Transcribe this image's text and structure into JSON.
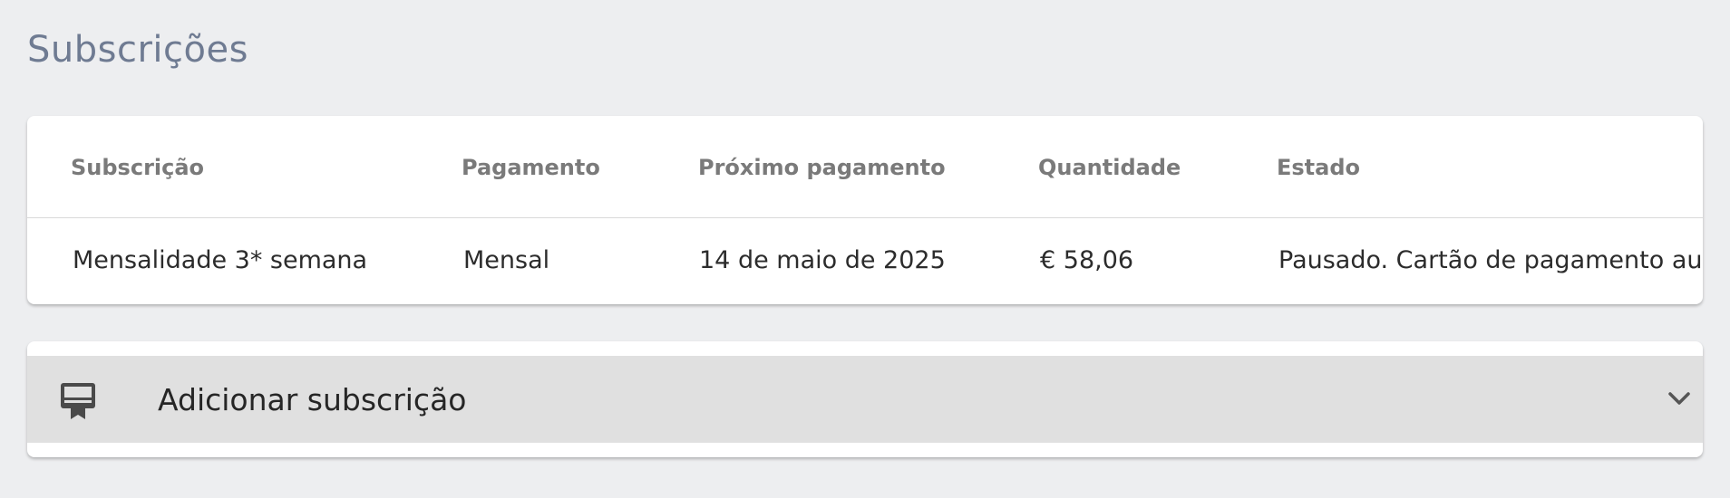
{
  "page": {
    "title": "Subscrições"
  },
  "table": {
    "headers": [
      "Subscrição",
      "Pagamento",
      "Próximo pagamento",
      "Quantidade",
      "Estado"
    ],
    "rows": [
      {
        "subscription": "Mensalidade 3* semana",
        "payment": "Mensal",
        "next_payment": "14 de maio de 2025",
        "amount": "€ 58,06",
        "status": "Pausado. Cartão de pagamento aus"
      }
    ]
  },
  "add_subscription": {
    "label": "Adicionar subscrição",
    "icon": "card-membership-icon",
    "expand_icon": "chevron-down-icon"
  },
  "colors": {
    "background": "#edeef0",
    "title": "#6f7b92",
    "header_text": "#7a7a7a",
    "add_bar": "#e0e0e0"
  }
}
